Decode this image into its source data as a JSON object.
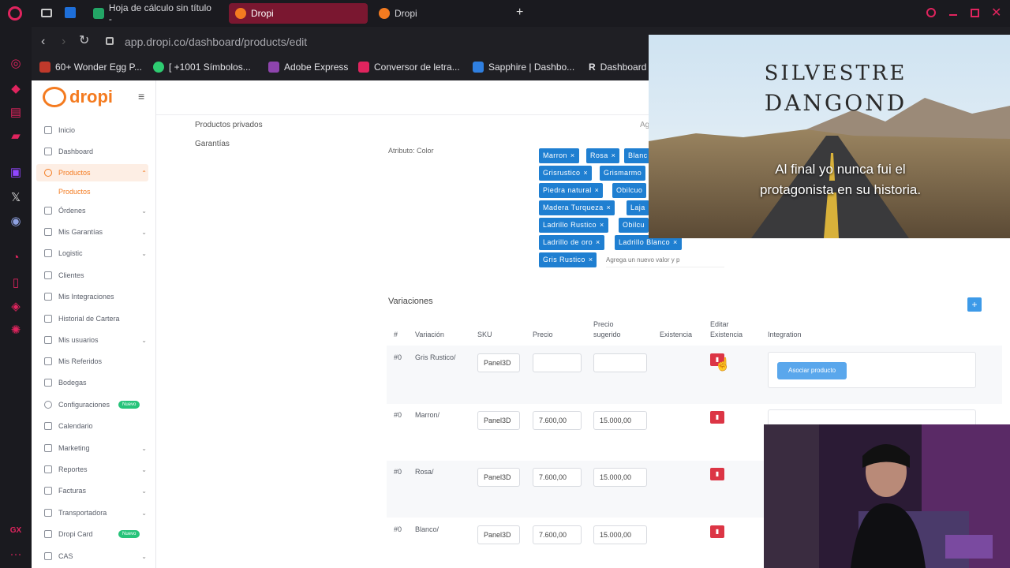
{
  "browser": {
    "tabs": [
      {
        "label": "Hoja de cálculo sin título -"
      },
      {
        "label": "Dropi"
      },
      {
        "label": "Dropi"
      }
    ],
    "new_tab": "+",
    "url": "app.dropi.co/dashboard/products/edit",
    "bookmarks": [
      "60+ Wonder Egg P...",
      "[ +1001 Símbolos...",
      "Adobe Express",
      "Conversor de letra...",
      "Sapphire | Dashbo...",
      "Dashboard"
    ]
  },
  "sidebar": {
    "logo": "dropi",
    "items": [
      {
        "label": "Inicio"
      },
      {
        "label": "Dashboard"
      },
      {
        "label": "Productos"
      },
      {
        "label": "Productos"
      },
      {
        "label": "Órdenes"
      },
      {
        "label": "Mis Garantías"
      },
      {
        "label": "Logistic"
      },
      {
        "label": "Clientes"
      },
      {
        "label": "Mis Integraciones"
      },
      {
        "label": "Historial de Cartera"
      },
      {
        "label": "Mis usuarios"
      },
      {
        "label": "Mis Referidos"
      },
      {
        "label": "Bodegas"
      },
      {
        "label": "Configuraciones",
        "badge": "Nuevo"
      },
      {
        "label": "Calendario"
      },
      {
        "label": "Marketing"
      },
      {
        "label": "Reportes"
      },
      {
        "label": "Facturas"
      },
      {
        "label": "Transportadora"
      },
      {
        "label": "Dropi Card",
        "badge": "Nuevo"
      },
      {
        "label": "CAS"
      }
    ]
  },
  "content": {
    "left_menu": [
      "Productos privados",
      "Garantías"
    ],
    "partial_ag": "Ag",
    "attribute_label": "Atributo: Color",
    "tags": [
      "Marron",
      "Rosa",
      "Blanc",
      "Grisrustico",
      "Grismarmo",
      "Piedra natural",
      "Obilcuo",
      "Madera Turqueza",
      "Laja",
      "Ladrillo Rustico",
      "Obilcu",
      "Ladrillo de oro",
      "Ladrillo Blanco",
      "Gris Rustico"
    ],
    "tag_placeholder": "Agrega un nuevo valor y p",
    "variations_title": "Variaciones",
    "add_button": "+",
    "table": {
      "headers": [
        "#",
        "Variación",
        "SKU",
        "Precio",
        "Precio sugerido",
        "Existencia",
        "Editar Existencia",
        "Integration"
      ],
      "rows": [
        {
          "num": "#0",
          "variation": "Gris Rustico/",
          "sku": "Panel3D",
          "price": "",
          "suggested": "",
          "action": "Asociar producto"
        },
        {
          "num": "#0",
          "variation": "Marron/",
          "sku": "Panel3D",
          "price": "7.600,00",
          "suggested": "15.000,00"
        },
        {
          "num": "#0",
          "variation": "Rosa/",
          "sku": "Panel3D",
          "price": "7.600,00",
          "suggested": "15.000,00"
        },
        {
          "num": "#0",
          "variation": "Blanco/",
          "sku": "Panel3D",
          "price": "7.600,00",
          "suggested": "15.000,00"
        }
      ]
    }
  },
  "overlay": {
    "poster_title_1": "SILVESTRE",
    "poster_title_2": "DANGOND",
    "poster_quote": "Al final yo nunca fui el protagonista en su historia."
  },
  "colors": {
    "accent": "#f47b20",
    "tag": "#1f7fd1",
    "delete": "#dc3545",
    "tab_active": "#7a1730"
  }
}
